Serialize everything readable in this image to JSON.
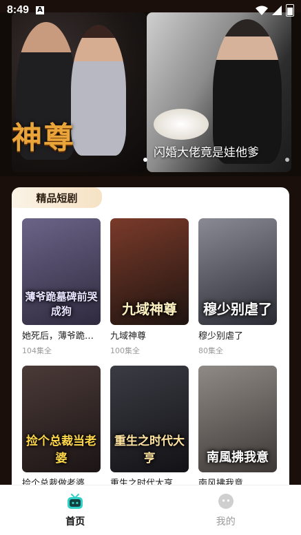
{
  "status_bar": {
    "time": "8:49",
    "notif_badge": "A"
  },
  "banner": {
    "slides": [
      {
        "title": "神尊"
      },
      {
        "caption": "闪婚大佬竟是娃他爹"
      }
    ]
  },
  "section": {
    "title": "精品短剧"
  },
  "dramas": [
    {
      "title": "她死后，薄爷跪…",
      "count": "104集全",
      "poster_text": "薄爷跪墓碑前哭成狗",
      "colors": [
        "#6b6488",
        "#2f2a3e"
      ]
    },
    {
      "title": "九域神尊",
      "count": "100集全",
      "poster_text": "九域神尊",
      "colors": [
        "#7a3a2a",
        "#1e1410"
      ]
    },
    {
      "title": "穆少别虐了",
      "count": "80集全",
      "poster_text": "穆少别虐了",
      "colors": [
        "#6e6e78",
        "#2b2b34"
      ]
    },
    {
      "title": "捡个总裁做老婆",
      "count": "",
      "poster_text": "捡个总裁当老婆",
      "colors": [
        "#4a3a38",
        "#1c1515"
      ]
    },
    {
      "title": "重生之时代大亨",
      "count": "",
      "poster_text": "重生之时代大亨",
      "colors": [
        "#3b3b44",
        "#121216"
      ]
    },
    {
      "title": "南风拂我意",
      "count": "",
      "poster_text": "南風拂我意",
      "colors": [
        "#8f8a86",
        "#3d3835"
      ]
    }
  ],
  "nav": {
    "home": "首页",
    "mine": "我的"
  },
  "colors": {
    "accent": "#2fd1c7",
    "inactive": "#9b9b9b"
  }
}
